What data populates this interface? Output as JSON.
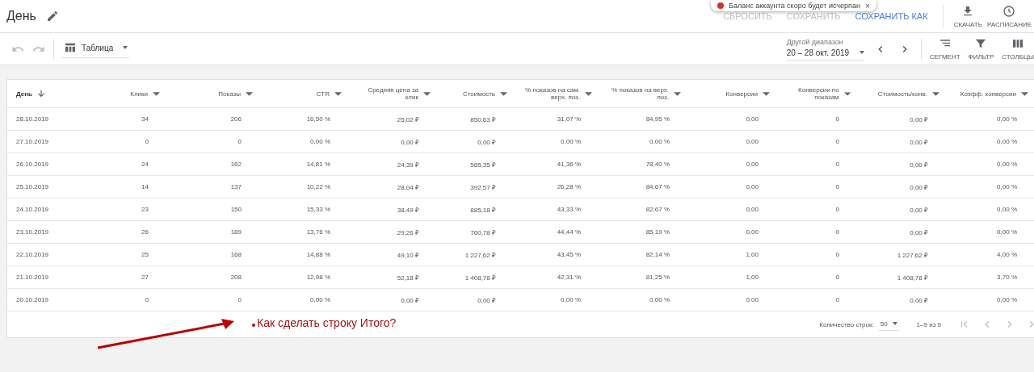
{
  "header": {
    "title": "День",
    "toast": "Баланс аккаунта скоро будет исчерпан",
    "toast_close": "×",
    "actions": [
      {
        "label": "СБРОСИТЬ",
        "disabled": true
      },
      {
        "label": "СОХРАНИТЬ",
        "disabled": true
      },
      {
        "label": "СОХРАНИТЬ КАК",
        "disabled": false
      }
    ],
    "tools": [
      {
        "kind": "download",
        "label": "СКАЧАТЬ"
      },
      {
        "kind": "schedule",
        "label": "РАСПИСАНИЕ"
      }
    ]
  },
  "toolbar": {
    "view": "Таблица",
    "range_label": "Другой диапазон",
    "range": "20 – 28 окт. 2019",
    "tools": [
      {
        "kind": "segment",
        "label": "СЕГМЕНТ"
      },
      {
        "kind": "filter",
        "label": "ФИЛЬТР"
      },
      {
        "kind": "columns",
        "label": "СТОЛБЦЫ"
      }
    ]
  },
  "table": {
    "columns": [
      {
        "label": "День",
        "kind": "sorted"
      },
      {
        "label": "Клики",
        "kind": "menu"
      },
      {
        "label": "Показы",
        "kind": "menu"
      },
      {
        "label": "CTR",
        "kind": "menu"
      },
      {
        "label": "Средняя цена за клик",
        "kind": "menu"
      },
      {
        "label": "Стоимость",
        "kind": "menu"
      },
      {
        "label": "% показов на сам. верх. поз.",
        "kind": "menu"
      },
      {
        "label": "% показов на верх. поз.",
        "kind": "menu"
      },
      {
        "label": "Конверсии",
        "kind": "menu"
      },
      {
        "label": "Конверсии по показам",
        "kind": "menu"
      },
      {
        "label": "Стоимость/конв.",
        "kind": "menu"
      },
      {
        "label": "Коэфф. конверсии",
        "kind": "menu"
      }
    ],
    "rows": [
      [
        "28.10.2019",
        "34",
        "206",
        "16,50 %",
        "25,02 ₽",
        "850,63 ₽",
        "31,07 %",
        "84,95 %",
        "0,00",
        "0",
        "0,00 ₽",
        "0,00 %"
      ],
      [
        "27.10.2019",
        "0",
        "0",
        "0,00 %",
        "0,00 ₽",
        "0,00 ₽",
        "0,00 %",
        "0,00 %",
        "0,00",
        "0",
        "0,00 ₽",
        "0,00 %"
      ],
      [
        "26.10.2019",
        "24",
        "162",
        "14,81 %",
        "24,39 ₽",
        "585,35 ₽",
        "41,36 %",
        "78,40 %",
        "0,00",
        "0",
        "0,00 ₽",
        "0,00 %"
      ],
      [
        "25.10.2019",
        "14",
        "137",
        "10,22 %",
        "28,04 ₽",
        "392,57 ₽",
        "26,28 %",
        "84,67 %",
        "0,00",
        "0",
        "0,00 ₽",
        "0,00 %"
      ],
      [
        "24.10.2019",
        "23",
        "150",
        "15,33 %",
        "38,49 ₽",
        "885,18 ₽",
        "43,33 %",
        "82,67 %",
        "0,00",
        "0",
        "0,00 ₽",
        "0,00 %"
      ],
      [
        "23.10.2019",
        "26",
        "189",
        "13,76 %",
        "29,26 ₽",
        "760,78 ₽",
        "44,44 %",
        "85,19 %",
        "0,00",
        "0",
        "0,00 ₽",
        "0,00 %"
      ],
      [
        "22.10.2019",
        "25",
        "168",
        "14,88 %",
        "49,10 ₽",
        "1 227,62 ₽",
        "43,45 %",
        "82,14 %",
        "1,00",
        "0",
        "1 227,62 ₽",
        "4,00 %"
      ],
      [
        "21.10.2019",
        "27",
        "208",
        "12,98 %",
        "52,18 ₽",
        "1 408,78 ₽",
        "42,31 %",
        "81,25 %",
        "1,00",
        "0",
        "1 408,78 ₽",
        "3,70 %"
      ],
      [
        "20.10.2019",
        "0",
        "0",
        "0,00 %",
        "0,00 ₽",
        "0,00 ₽",
        "0,00 %",
        "0,00 %",
        "0,00",
        "0",
        "0,00 ₽",
        "0,00 %"
      ]
    ]
  },
  "pagination": {
    "rows_label": "Количество строк:",
    "rows_value": "50",
    "range": "1–9 из 9"
  },
  "annotation": {
    "text": "Как сделать строку Итого?"
  }
}
